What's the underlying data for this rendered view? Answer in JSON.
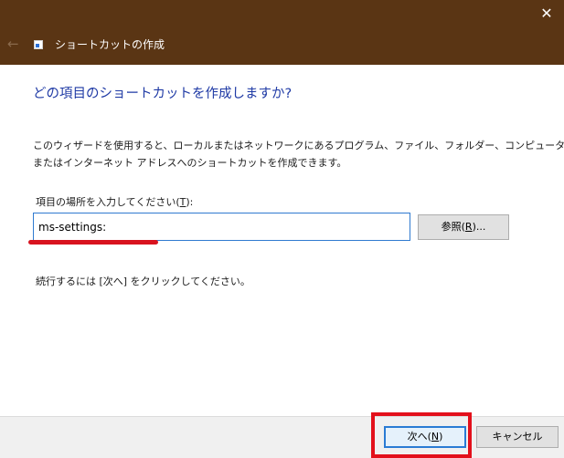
{
  "window": {
    "title": "ショートカットの作成",
    "close_glyph": "✕",
    "back_glyph": "←"
  },
  "main": {
    "heading": "どの項目のショートカットを作成しますか?",
    "description_line1": "このウィザードを使用すると、ローカルまたはネットワークにあるプログラム、ファイル、フォルダー、コンピューター、",
    "description_line2": "またはインターネット アドレスへのショートカットを作成できます。",
    "location_label_pre": "項目の場所を入力してください(",
    "location_label_key": "T",
    "location_label_post": "):",
    "location_value": "ms-settings:",
    "browse_label_pre": "参照(",
    "browse_label_key": "R",
    "browse_label_post": ")...",
    "instruction": "続行するには [次へ] をクリックしてください。"
  },
  "footer": {
    "next_label_pre": "次へ(",
    "next_label_key": "N",
    "next_label_post": ")",
    "cancel_label": "キャンセル"
  },
  "colors": {
    "titlebar": "#5a3514",
    "heading": "#1f3aa5",
    "input_border": "#2f7ad0",
    "annotation_red": "#e3101b"
  }
}
